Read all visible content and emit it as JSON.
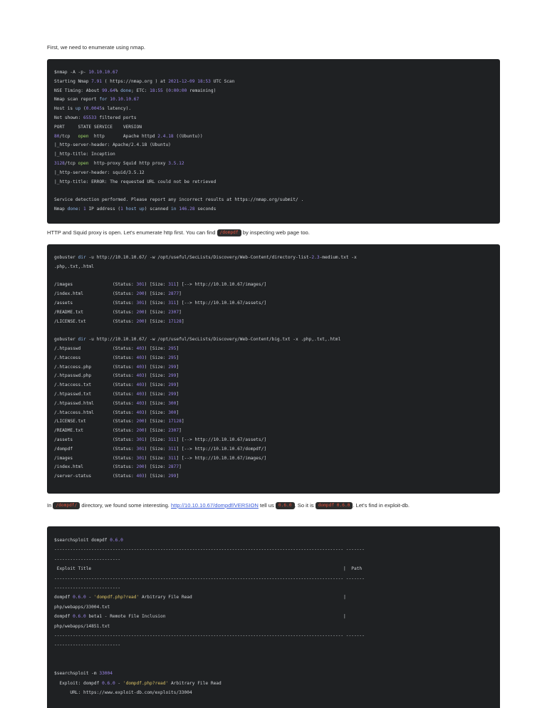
{
  "intro": {
    "text": "First, we need to enumerate using nmap."
  },
  "nmap_lines": [
    "$nmap -A -p- 10.10.10.67",
    "Starting Nmap 7.91 ( https://nmap.org ) at 2021-12-09 18:53 UTC Scan",
    "NSE Timing: About 99.64% done; ETC: 18:55 (0:00:00 remaining)",
    "Nmap scan report for 10.10.10.67",
    "Host is up (0.0045s latency).",
    "Not shown: 65533 filtered ports",
    "PORT     STATE SERVICE    VERSION",
    "80/tcp   open  http       Apache httpd 2.4.18 ((Ubuntu))",
    "|_http-server-header: Apache/2.4.18 (Ubuntu)",
    "|_http-title: Inception",
    "3128/tcp open  http-proxy Squid http proxy 3.5.12",
    "|_http-server-header: squid/3.5.12",
    "|_http-title: ERROR: The requested URL could not be retrieved",
    "",
    "Service detection performed. Please report any incorrect results at https://nmap.org/submit/ .",
    "Nmap done: 1 IP address (1 host up) scanned in 146.28 seconds"
  ],
  "para2": {
    "before": "HTTP and Squid proxy is open. Let's enumerate http first. You can find ",
    "code": "/dompdf",
    "after": " by inspecting web page too."
  },
  "gobuster_lines": [
    "gobuster dir -u http://10.10.10.67/ -w /opt/useful/SecLists/Discovery/Web-Content/directory-list-2.3-medium.txt -x",
    ".php,.txt,.html",
    "",
    "/images               (Status: 301) [Size: 311] [--> http://10.10.10.67/images/]",
    "/index.html           (Status: 200) [Size: 2877]",
    "/assets               (Status: 301) [Size: 311] [--> http://10.10.10.67/assets/]",
    "/README.txt           (Status: 200) [Size: 2307]",
    "/LICENSE.txt          (Status: 200) [Size: 17128]",
    "",
    "gobuster dir -u http://10.10.10.67/ -w /opt/useful/SecLists/Discovery/Web-Content/big.txt -x .php,.txt,.html",
    "/.htpasswd            (Status: 403) [Size: 295]",
    "/.htaccess            (Status: 403) [Size: 295]",
    "/.htaccess.php        (Status: 403) [Size: 299]",
    "/.htpasswd.php        (Status: 403) [Size: 299]",
    "/.htaccess.txt        (Status: 403) [Size: 299]",
    "/.htpasswd.txt        (Status: 403) [Size: 299]",
    "/.htpasswd.html       (Status: 403) [Size: 300]",
    "/.htaccess.html       (Status: 403) [Size: 300]",
    "/LICENSE.txt          (Status: 200) [Size: 17128]",
    "/README.txt           (Status: 200) [Size: 2307]",
    "/assets               (Status: 301) [Size: 311] [--> http://10.10.10.67/assets/]",
    "/dompdf               (Status: 301) [Size: 311] [--> http://10.10.10.67/dompdf/]",
    "/images               (Status: 301) [Size: 311] [--> http://10.10.10.67/images/]",
    "/index.html           (Status: 200) [Size: 2877]",
    "/server-status        (Status: 403) [Size: 299]"
  ],
  "para3": {
    "t1": "In ",
    "code1": "/dompdf/",
    "t2": " directory, we found some interesting. ",
    "link": "http://10.10.10.67/dompdf/VERSION",
    "t3": " tell us ",
    "code2": "0.6.0",
    "t4": ". So it is ",
    "code3": "dompdf 0.6.0",
    "t5": ". Let's find in exploit-db."
  },
  "searchsploit_lines": [
    "$searchsploit dompdf 0.6.0",
    "------------------------------------------------------------------------------------------------------------- -------",
    "-------------------------",
    " Exploit Title                                                                                               |  Path",
    "------------------------------------------------------------------------------------------------------------- -------",
    "-------------------------",
    "dompdf 0.6.0 - 'dompdf.php?read' Arbitrary File Read                                                         |",
    "php/webapps/33004.txt",
    "dompdf 0.6.0 beta1 - Remote File Inclusion                                                                   |",
    "php/webapps/14851.txt",
    "------------------------------------------------------------------------------------------------------------- -------",
    "-------------------------",
    "",
    "",
    "$searchsploit -m 33004",
    "  Exploit: dompdf 0.6.0 - 'dompdf.php?read' Arbitrary File Read",
    "      URL: https://www.exploit-db.com/exploits/33004"
  ]
}
